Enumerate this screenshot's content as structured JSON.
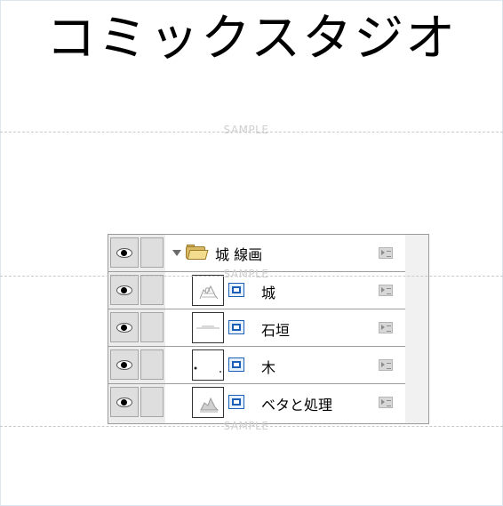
{
  "title": "コミックスタジオ",
  "watermark": "SAMPLE",
  "layers_panel": {
    "folder": {
      "label": "城 線画",
      "expanded": true,
      "visible": true
    },
    "layers": [
      {
        "label": "城",
        "visible": true,
        "thumbnail": "castle-sketch"
      },
      {
        "label": "石垣",
        "visible": true,
        "thumbnail": "stone-wall-lines"
      },
      {
        "label": "木",
        "visible": true,
        "thumbnail": "tree-dots"
      },
      {
        "label": "ベタと処理",
        "visible": true,
        "thumbnail": "castle-fill"
      }
    ]
  },
  "icons": {
    "eye": "eye-icon",
    "folder": "folder-open-icon",
    "layer": "raster-layer-icon",
    "properties": "layer-properties-icon",
    "expand": "triangle-down-icon"
  },
  "colors": {
    "background": "#ffffff",
    "panel": "#ececec",
    "layer_icon": "#1b5fb8",
    "folder_icon": "#d8b863"
  }
}
